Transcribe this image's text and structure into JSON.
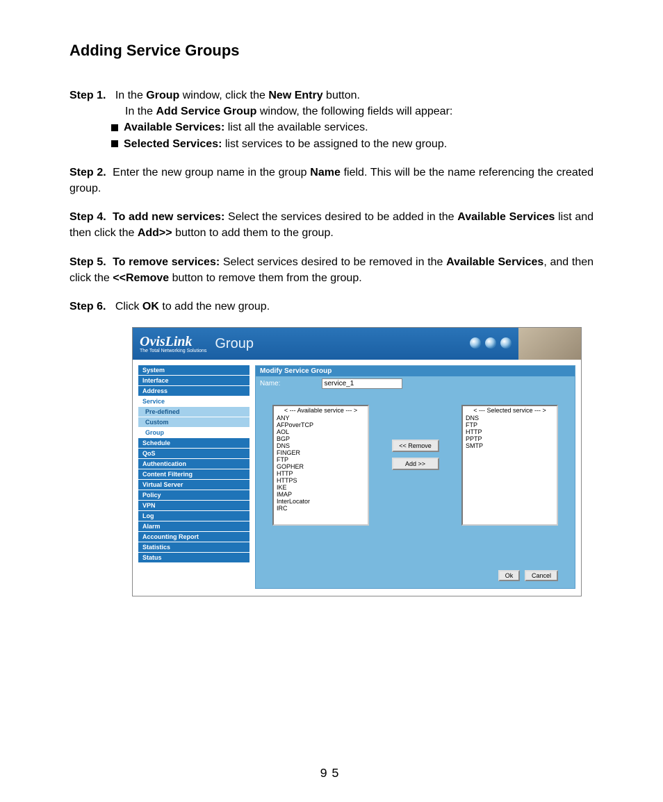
{
  "doc": {
    "title": "Adding Service Groups",
    "page_number": "95",
    "step1_label": "Step 1.",
    "step1_a": "In the ",
    "step1_group": "Group",
    "step1_b": " window, click the ",
    "step1_newentry": "New Entry",
    "step1_c": " button.",
    "step1_d": "In the ",
    "step1_add": "Add Service Group",
    "step1_e": " window, the following fields will appear:",
    "bullet1_label": "Available Services:",
    "bullet1_text": " list all the available services.",
    "bullet2_label": "Selected Services:",
    "bullet2_text": " list services to be assigned to the new group.",
    "step2_label": "Step 2.",
    "step2_a": "Enter the new group name in the group ",
    "step2_name": "Name",
    "step2_b": " field.  This will be the name referencing the created group.",
    "step4_label": "Step 4.",
    "step4_bold1": "To add new services:",
    "step4_a": " Select the services desired to be added in the ",
    "step4_bold2": "Available Services",
    "step4_b": " list and then click the ",
    "step4_bold3": "Add>>",
    "step4_c": " button to add them to the group.",
    "step5_label": "Step 5.",
    "step5_bold1": "To remove services:",
    "step5_a": " Select services desired to be removed in the ",
    "step5_bold2": "Available Services",
    "step5_b": ", and then click the ",
    "step5_bold3": "<<Remove",
    "step5_c": " button to remove them from the group.",
    "step6_label": "Step 6.",
    "step6_a": "Click ",
    "step6_ok": "OK",
    "step6_b": " to add the new group."
  },
  "ui": {
    "brand": "OvisLink",
    "brand_tag": "The Total Networking Solutions",
    "header_title": "Group",
    "sidebar": [
      "System",
      "Interface",
      "Address",
      "Service"
    ],
    "sidebar_subs": [
      "Pre-defined",
      "Custom",
      "Group"
    ],
    "sidebar2": [
      "Schedule",
      "QoS",
      "Authentication",
      "Content Filtering",
      "Virtual Server",
      "Policy",
      "VPN",
      "Log",
      "Alarm",
      "Accounting Report",
      "Statistics",
      "Status"
    ],
    "panel_title": "Modify Service Group",
    "name_label": "Name:",
    "name_value": "service_1",
    "available_header": "< --- Available service --- >",
    "selected_header": "< --- Selected service --- >",
    "available": [
      "ANY",
      "AFPoverTCP",
      "AOL",
      "BGP",
      "DNS",
      "FINGER",
      "FTP",
      "GOPHER",
      "HTTP",
      "HTTPS",
      "IKE",
      "IMAP",
      "InterLocator",
      "IRC"
    ],
    "selected": [
      "DNS",
      "FTP",
      "HTTP",
      "PPTP",
      "SMTP"
    ],
    "btn_remove": "<< Remove",
    "btn_add": "Add  >>",
    "btn_ok": "Ok",
    "btn_cancel": "Cancel"
  }
}
